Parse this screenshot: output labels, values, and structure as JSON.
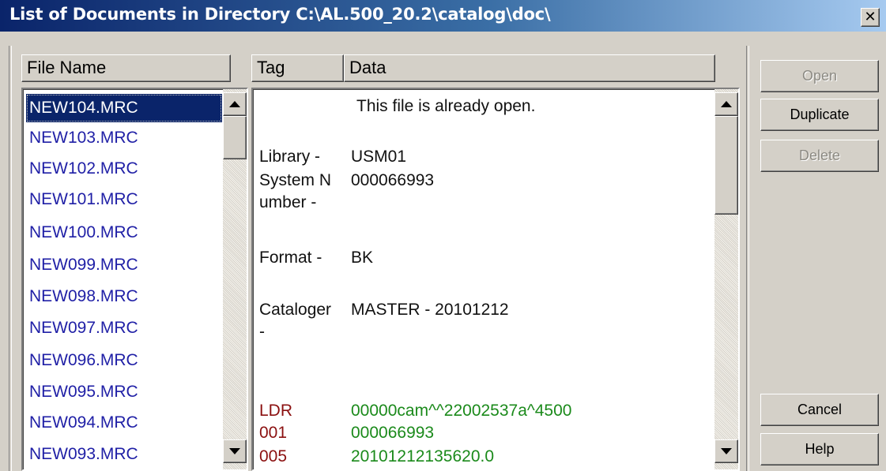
{
  "window": {
    "title": "List of Documents in Directory C:\\AL.500_20.2\\catalog\\doc\\",
    "close_label": "✕"
  },
  "file_list": {
    "header": "File Name",
    "items": [
      "NEW104.MRC",
      "NEW103.MRC",
      "NEW102.MRC",
      "NEW101.MRC",
      "NEW100.MRC",
      "NEW099.MRC",
      "NEW098.MRC",
      "NEW097.MRC",
      "NEW096.MRC",
      "NEW095.MRC",
      "NEW094.MRC",
      "NEW093.MRC"
    ],
    "selected": "NEW104.MRC"
  },
  "preview": {
    "tag_header": "Tag",
    "data_header": "Data",
    "notice": "This file is already open.",
    "fields": [
      {
        "tag": "Library -",
        "value": "USM01"
      },
      {
        "tag": "System Number -",
        "value": "000066993"
      },
      {
        "tag": "Format -",
        "value": "BK"
      },
      {
        "tag": "Cataloger -",
        "value": "MASTER - 20101212"
      }
    ],
    "records": [
      {
        "tag": "LDR",
        "value": "00000cam^^22002537a^4500"
      },
      {
        "tag": "001",
        "value": "000066993"
      },
      {
        "tag": "005",
        "value": "20101212135620.0"
      }
    ]
  },
  "buttons": {
    "open": "Open",
    "duplicate": "Duplicate",
    "delete": "Delete",
    "cancel": "Cancel",
    "help": "Help"
  },
  "colors": {
    "title_gradient_start": "#0a246a",
    "selection": "#0a246a",
    "file_text": "#1f1fa6",
    "tag_red": "#8b1010",
    "data_green": "#1b8a1b",
    "face": "#d4d0c8"
  }
}
